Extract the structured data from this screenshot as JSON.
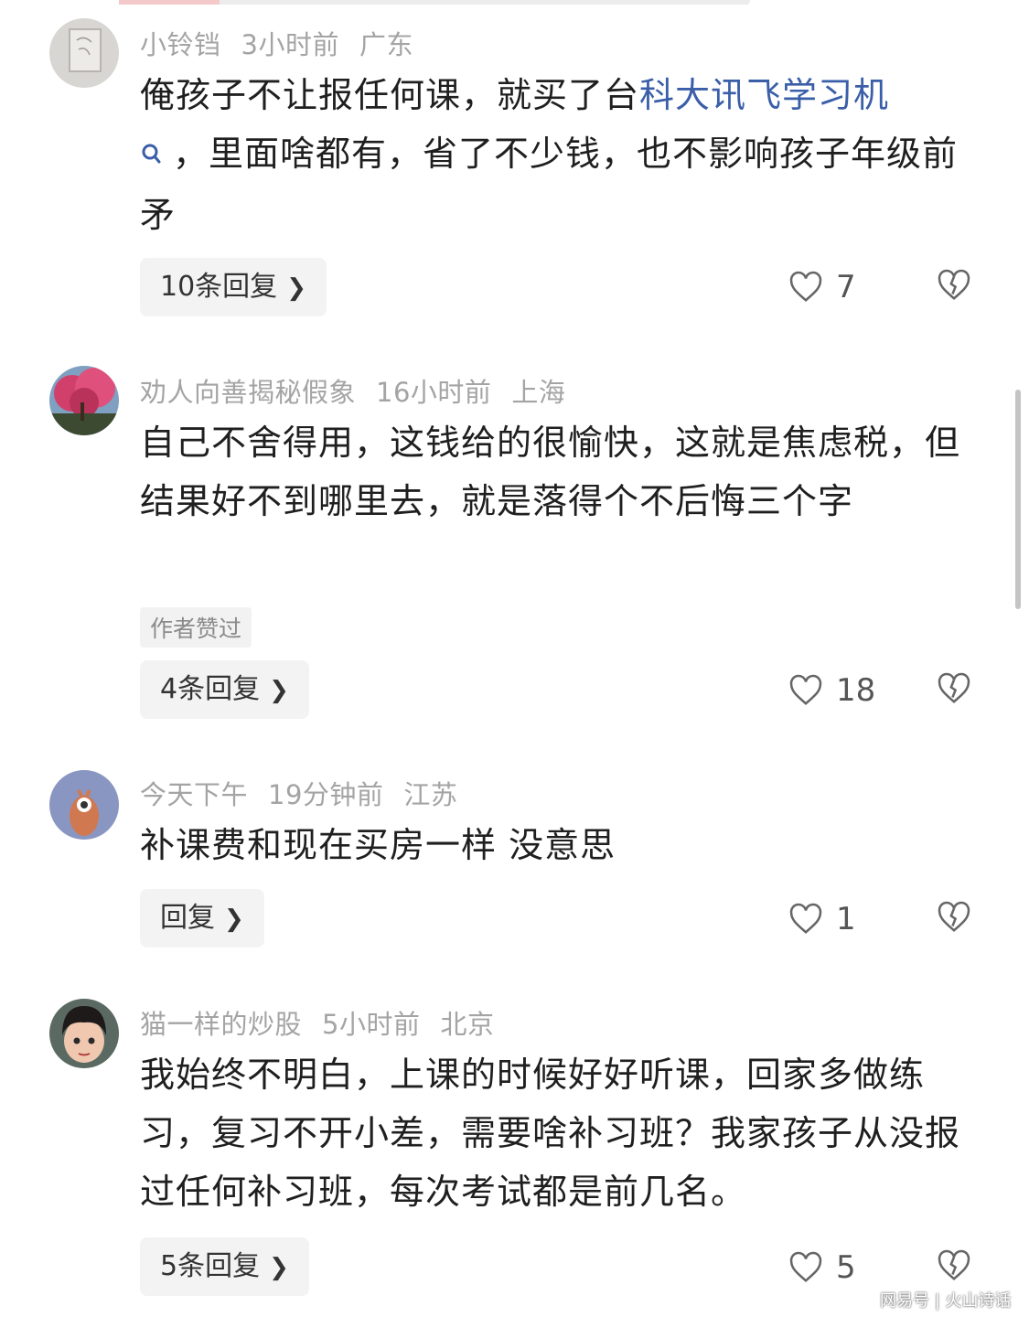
{
  "comments": [
    {
      "user": "小铃铛",
      "time": "3小时前",
      "location": "广东",
      "text_before": "俺孩子不让报任何课，就买了台",
      "link_text": "科大讯飞学习机",
      "text_after": "，里面啥都有，省了不少钱，也不影响孩子年级前矛",
      "replies": "10条回复",
      "likes": "7"
    },
    {
      "user": "劝人向善揭秘假象",
      "time": "16小时前",
      "location": "上海",
      "text": "自己不舍得用，这钱给的很愉快，这就是焦虑税，但结果好不到哪里去，就是落得个不后悔三个字",
      "author_tag": "作者赞过",
      "replies": "4条回复",
      "likes": "18"
    },
    {
      "user": "今天下午",
      "time": "19分钟前",
      "location": "江苏",
      "text": "补课费和现在买房一样 没意思",
      "replies": "回复",
      "likes": "1"
    },
    {
      "user": "猫一样的炒股",
      "time": "5小时前",
      "location": "北京",
      "text": "我始终不明白，上课的时候好好听课，回家多做练习，复习不开小差，需要啥补习班？我家孩子从没报过任何补习班，每次考试都是前几名。",
      "replies": "5条回复",
      "likes": "5"
    }
  ],
  "icons": {
    "reply_chevron": "chevron-right-icon",
    "like": "heart-icon",
    "dislike": "broken-heart-icon",
    "link_search": "search-icon"
  },
  "colors": {
    "link": "#3a5ea8",
    "meta": "#a4a4a4",
    "text": "#1f1f1f"
  },
  "watermark": "网易号 | 火山诗话"
}
